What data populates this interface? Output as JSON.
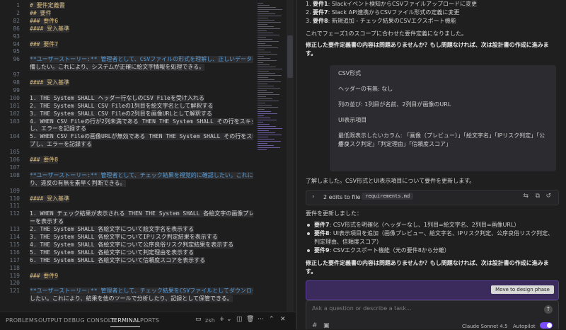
{
  "editor": {
    "lines": [
      {
        "n": "1",
        "t": "# 要件定義書",
        "cls": "h"
      },
      {
        "n": "2",
        "t": "## 要件",
        "cls": "h"
      },
      {
        "n": "82",
        "t": "### 要件6",
        "cls": "h"
      },
      {
        "n": "86",
        "t": "#### 受入基準",
        "cls": "h"
      },
      {
        "n": "93",
        "t": "",
        "cls": "tx"
      },
      {
        "n": "94",
        "t": "### 要件7",
        "cls": "h"
      },
      {
        "n": "95",
        "t": "",
        "cls": "tx"
      },
      {
        "n": "96",
        "t": "**ユーザーストーリー:** 管理者として、CSVファイルの形式を理解し、正しいデータを準",
        "cls": "us"
      },
      {
        "n": "",
        "t": "備したい。これにより、システムが正確に絵文字情報を処理できる。",
        "cls": "tx"
      },
      {
        "n": "97",
        "t": "",
        "cls": "tx"
      },
      {
        "n": "98",
        "t": "#### 受入基準",
        "cls": "h"
      },
      {
        "n": "99",
        "t": "",
        "cls": "tx"
      },
      {
        "n": "100",
        "t": "1. THE System SHALL ヘッダー行なしのCSV Fileを受け入れる",
        "cls": "tx"
      },
      {
        "n": "101",
        "t": "2. THE System SHALL CSV Fileの1列目を絵文字名として解釈する",
        "cls": "tx"
      },
      {
        "n": "102",
        "t": "3. THE System SHALL CSV Fileの2列目を画像URLとして解釈する",
        "cls": "tx"
      },
      {
        "n": "103",
        "t": "4. WHEN CSV Fileの行が2列未満である THEN THE System SHALL その行をスキップ",
        "cls": "tx"
      },
      {
        "n": "",
        "t": "し、エラーを記録する",
        "cls": "tx"
      },
      {
        "n": "104",
        "t": "5. WHEN CSV Fileの画像URLが無効である THEN THE System SHALL その行をスキッ",
        "cls": "tx"
      },
      {
        "n": "",
        "t": "プし、エラーを記録する",
        "cls": "tx"
      },
      {
        "n": "105",
        "t": "",
        "cls": "tx"
      },
      {
        "n": "106",
        "t": "### 要件8",
        "cls": "h"
      },
      {
        "n": "107",
        "t": "",
        "cls": "tx"
      },
      {
        "n": "108",
        "t": "**ユーザーストーリー:** 管理者として、チェック結果を視覚的に確認したい。これによ",
        "cls": "us"
      },
      {
        "n": "",
        "t": "り、違反の有無を素早く判断できる。",
        "cls": "tx"
      },
      {
        "n": "109",
        "t": "",
        "cls": "tx"
      },
      {
        "n": "110",
        "t": "#### 受入基準",
        "cls": "h"
      },
      {
        "n": "111",
        "t": "",
        "cls": "tx"
      },
      {
        "n": "112",
        "t": "1. WHEN チェック結果が表示される THEN THE System SHALL 各絵文字の画像プレビュ",
        "cls": "tx"
      },
      {
        "n": "",
        "t": "ーを表示する",
        "cls": "tx"
      },
      {
        "n": "113",
        "t": "2. THE System SHALL 各絵文字について絵文字名を表示する",
        "cls": "tx"
      },
      {
        "n": "114",
        "t": "3. THE System SHALL 各絵文字についてIPリスク判定結果を表示する",
        "cls": "tx"
      },
      {
        "n": "115",
        "t": "4. THE System SHALL 各絵文字について公序良俗リスク判定結果を表示する",
        "cls": "tx"
      },
      {
        "n": "116",
        "t": "5. THE System SHALL 各絵文字について判定理由を表示する",
        "cls": "tx"
      },
      {
        "n": "117",
        "t": "6. THE System SHALL 各絵文字について信頼度スコアを表示する",
        "cls": "tx"
      },
      {
        "n": "118",
        "t": "",
        "cls": "tx"
      },
      {
        "n": "119",
        "t": "### 要件9",
        "cls": "h"
      },
      {
        "n": "120",
        "t": "",
        "cls": "tx"
      },
      {
        "n": "121",
        "t": "**ユーザーストーリー:** 管理者として、チェック結果をCSVファイルとしてダウンロード",
        "cls": "us"
      },
      {
        "n": "",
        "t": "したい。これにより、結果を他のツールで分析したり、記録として保管できる。",
        "cls": "tx"
      }
    ]
  },
  "panel": {
    "tabs": [
      "PROBLEMS",
      "OUTPUT",
      "DEBUG CONSOLE",
      "TERMINAL",
      "PORTS"
    ],
    "active_tab": "TERMINAL",
    "shell": "zsh"
  },
  "chat": {
    "list1": [
      {
        "num": "1.",
        "b": "要件1",
        "t": ": Slackイベント検知からCSVファイルアップロードに変更"
      },
      {
        "num": "2.",
        "b": "要件7",
        "t": ": Slack API連携からCSVファイル形式の定義に変更"
      },
      {
        "num": "3.",
        "b": "要件8",
        "t": ": 新規追加 - チェック結果のCSVエクスポート機能"
      }
    ],
    "summary1": "これでフェーズ1のスコープに合わせた要件定義になりました。",
    "question1": "修正した要件定義書の内容は問題ありませんか？もし問題なければ、次は設計書の作成に進みます。",
    "quote": [
      "CSV形式",
      "ヘッダーの有無: なし",
      "列の並び: 1列目が名前、2列目が画像のURL",
      "UI表示項目",
      "最低限表示したいカラム: 「画像（プレビュー）」「絵文字名」「IPリスク判定」「公序良",
      "俗リスク判定」「判定理由」「信頼度スコア」"
    ],
    "ack": "了解しました。CSV形式とUI表示項目について要件を更新します。",
    "edits_label": "2 edits to file",
    "edits_file": "requirements.md",
    "updated": "要件を更新しました：",
    "bullets": [
      {
        "b": "要件7",
        "t": ": CSV形式を明確化（ヘッダーなし、1列目=絵文字名、2列目=画像URL）"
      },
      {
        "b": "要件8",
        "t": ": UI表示項目を追加（画像プレビュー、絵文字名、IPリスク判定、公序良俗リスク判定、"
      },
      {
        "b": "",
        "t": "判定理由、信頼度スコア）"
      },
      {
        "b": "要件9",
        "t": ": CSVエクスポート機能（元の要件8から分離）"
      }
    ],
    "question2": "修正した要件定義書の内容は問題ありませんか？もし問題なければ、次は設計書の作成に進みます。",
    "design_button": "Move to design phase",
    "input_placeholder": "Ask a question or describe a task...",
    "model": "Claude Sonnet 4.5",
    "autopilot": "Autopilot"
  }
}
